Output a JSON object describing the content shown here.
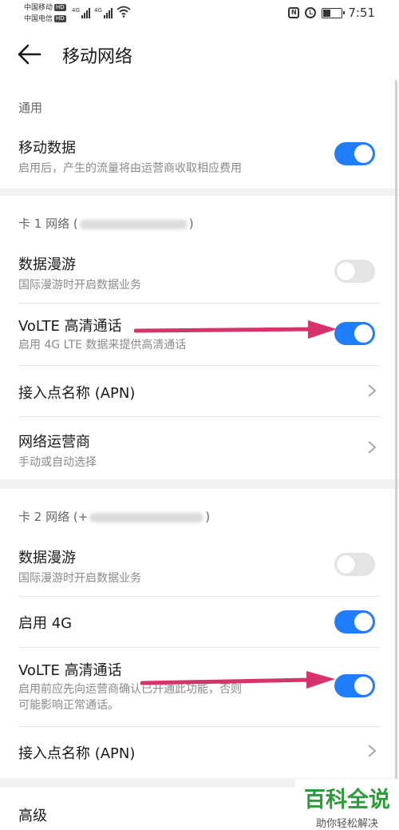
{
  "status_bar": {
    "carrier_1": "中国移动",
    "carrier_2": "中国电信",
    "hd_badge": "HD",
    "network_1": "4G",
    "network_2": "4G",
    "nfc": "N",
    "time": "7:51",
    "icons": [
      "signal-icon",
      "wifi-icon",
      "nfc-icon",
      "alarm-icon",
      "battery-icon"
    ]
  },
  "app_bar": {
    "title": "移动网络",
    "back_icon": "back-arrow-icon"
  },
  "sections": {
    "general": {
      "header": "通用",
      "mobile_data": {
        "title": "移动数据",
        "subtitle": "启用后，产生的流量将由运营商收取相应费用",
        "enabled": true
      }
    },
    "sim1": {
      "header_prefix": "卡 1 网络 (",
      "header_suffix": ")",
      "roaming": {
        "title": "数据漫游",
        "subtitle": "国际漫游时开启数据业务",
        "enabled": false
      },
      "volte": {
        "title": "VoLTE 高清通话",
        "subtitle": "启用 4G LTE 数据来提供高清通话",
        "enabled": true
      },
      "apn": {
        "title": "接入点名称 (APN)"
      },
      "operator": {
        "title": "网络运营商",
        "subtitle": "手动或自动选择"
      }
    },
    "sim2": {
      "header_prefix": "卡 2 网络 (+",
      "header_suffix": ")",
      "roaming": {
        "title": "数据漫游",
        "subtitle": "国际漫游时开启数据业务",
        "enabled": false
      },
      "enable_4g": {
        "title": "启用 4G",
        "enabled": true
      },
      "volte": {
        "title": "VoLTE 高清通话",
        "subtitle_line1": "启用前应先向运营商确认已开通此功能，否则",
        "subtitle_line2": "可能影响正常通话。",
        "enabled": true
      },
      "apn": {
        "title": "接入点名称 (APN)"
      }
    },
    "advanced": {
      "title": "高级"
    }
  },
  "watermark": {
    "logo": "百科全说",
    "slogan": "助你轻松解决"
  },
  "colors": {
    "toggle_on": "#1f7eff",
    "toggle_off": "#e4e4e4",
    "annotation_arrow": "#d6336c",
    "background": "#f2f2f2",
    "watermark_green": "#2e9b3a"
  }
}
